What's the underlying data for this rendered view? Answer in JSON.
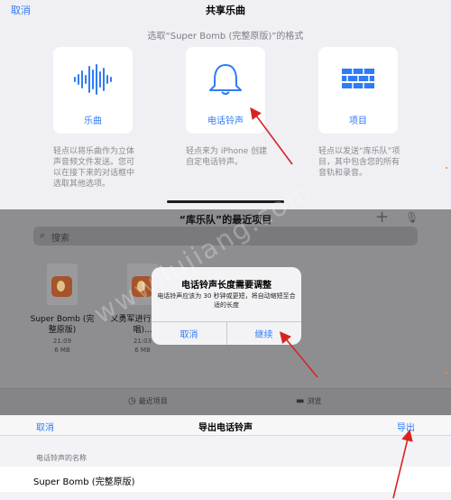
{
  "share": {
    "cancel": "取消",
    "title": "共享乐曲",
    "subtitle": "选取“Super Bomb (完整原版)”的格式",
    "options": [
      {
        "label": "乐曲",
        "icon": "waveform-icon",
        "desc": "轻点以将乐曲作为立体声音频文件发送。您可以在接下来的对话框中选取其他选项。"
      },
      {
        "label": "电话铃声",
        "icon": "bell-icon",
        "desc": "轻点来为 iPhone 创建自定电话铃声。"
      },
      {
        "label": "项目",
        "icon": "brick-wall-icon",
        "desc": "轻点以发送“库乐队”项目，其中包含您的所有音轨和录音。"
      }
    ]
  },
  "recent": {
    "title": "“库乐队”的最近项目",
    "search_placeholder": "搜索",
    "files": [
      {
        "name": "Super Bomb (完整原版)",
        "time": "21:09",
        "size": "6 MB"
      },
      {
        "name": "义勇军进行曲_(合唱)...",
        "time": "21:03",
        "size": "6 MB"
      }
    ],
    "tabs": [
      {
        "label": "最近项目",
        "icon": "clock-icon"
      },
      {
        "label": "浏览",
        "icon": "folder-icon"
      }
    ]
  },
  "alert": {
    "title": "电话铃声长度需要调整",
    "message": "电话铃声应该为 30 秒钟或更短，将自动缩短至合适的长度",
    "cancel": "取消",
    "continue": "继续"
  },
  "export": {
    "cancel": "取消",
    "title": "导出电话铃声",
    "export": "导出",
    "section": "电话铃声的名称",
    "name_value": "Super Bomb (完整原版)"
  },
  "watermark": "www.lujiang.com",
  "colors": {
    "accent": "#2f7cf6",
    "annotation_arrow": "#d62424"
  }
}
